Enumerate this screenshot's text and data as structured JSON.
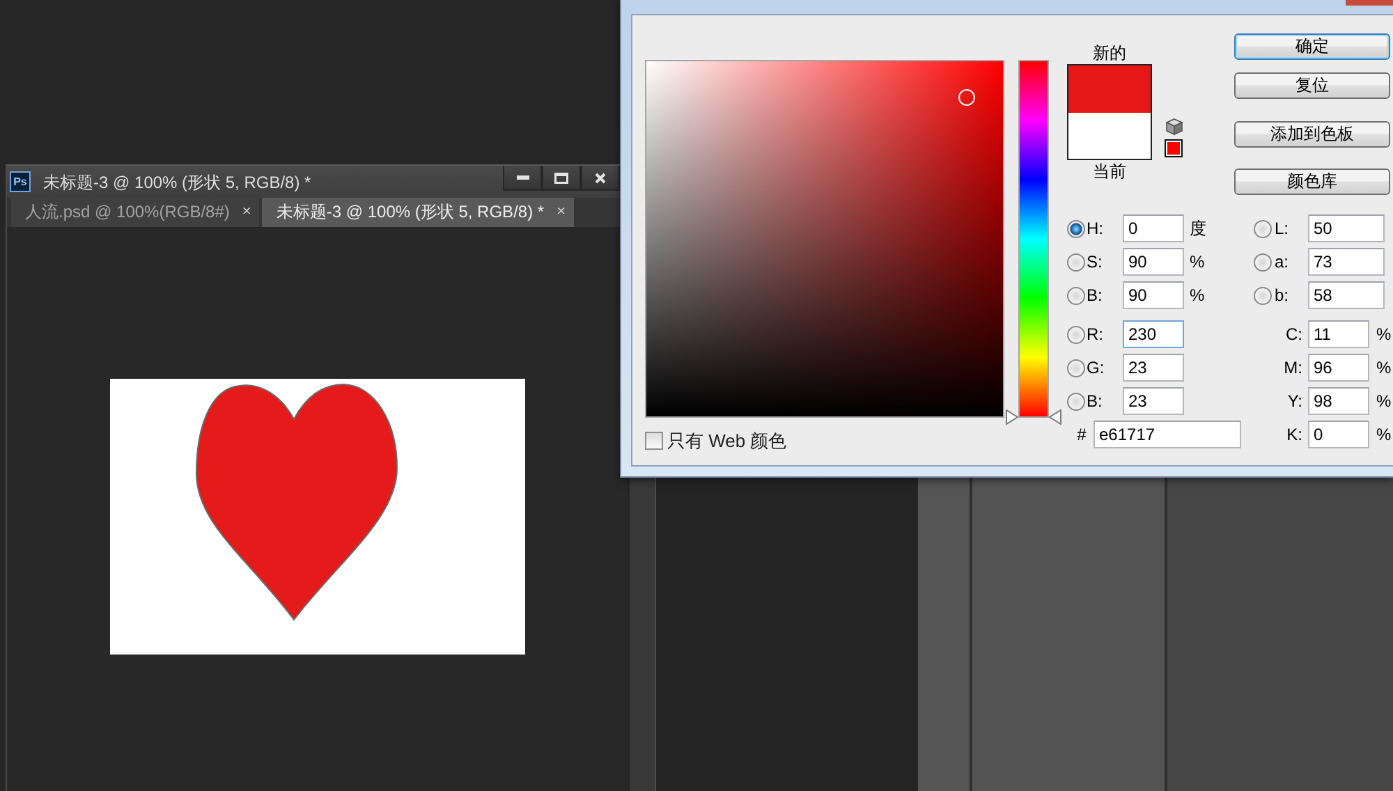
{
  "document_window": {
    "app_icon": "Ps",
    "title": "未标题-3 @ 100% (形状 5, RGB/8) *",
    "tabs": [
      {
        "label": "人流.psd @ 100%(RGB/8#)",
        "close": "×",
        "selected": false
      },
      {
        "label": "未标题-3 @ 100% (形状 5, RGB/8) *",
        "close": "×",
        "selected": true
      }
    ]
  },
  "color_picker": {
    "color_field": {
      "saturation": {
        "level": 0.9
      },
      "brightness": {
        "level": 0.9
      }
    },
    "hue_slider": {
      "level": 0
    },
    "web_colors_only": {
      "label": "只有 Web 颜色",
      "checked": false
    },
    "swatches": [
      {
        "label": "新的",
        "color": "#e61717"
      },
      {
        "label": "当前",
        "color": "#ffffff"
      }
    ],
    "web_safe_swatch": {
      "color": "#ff0000"
    },
    "buttons": [
      {
        "label": "确定",
        "default": true
      },
      {
        "label": "复位",
        "default": false
      },
      {
        "label": "添加到色板",
        "default": false
      },
      {
        "label": "颜色库",
        "default": false
      }
    ],
    "hsb_fields": [
      {
        "label": "H:",
        "value": "0",
        "unit": "度",
        "selected": true,
        "focused": false
      },
      {
        "label": "S:",
        "value": "90",
        "unit": "%",
        "selected": false,
        "focused": false
      },
      {
        "label": "B:",
        "value": "90",
        "unit": "%",
        "selected": false,
        "focused": false
      }
    ],
    "rgb_fields": [
      {
        "label": "R:",
        "value": "230",
        "selected": false,
        "focused": true
      },
      {
        "label": "G:",
        "value": "23",
        "selected": false,
        "focused": false
      },
      {
        "label": "B:",
        "value": "23",
        "selected": false,
        "focused": false
      }
    ],
    "hex_field": {
      "label": "#",
      "value": "e61717",
      "focused": false
    },
    "lab_fields": [
      {
        "label": "L:",
        "value": "50",
        "selected": false,
        "focused": false
      },
      {
        "label": "a:",
        "value": "73",
        "selected": false,
        "focused": false
      },
      {
        "label": "b:",
        "value": "58",
        "selected": false,
        "focused": false
      }
    ],
    "cmyk_fields": [
      {
        "label": "C:",
        "value": "11",
        "unit": "%",
        "focused": false
      },
      {
        "label": "M:",
        "value": "96",
        "unit": "%",
        "focused": false
      },
      {
        "label": "Y:",
        "value": "98",
        "unit": "%",
        "focused": false
      },
      {
        "label": "K:",
        "value": "0",
        "unit": "%",
        "focused": false
      }
    ]
  }
}
